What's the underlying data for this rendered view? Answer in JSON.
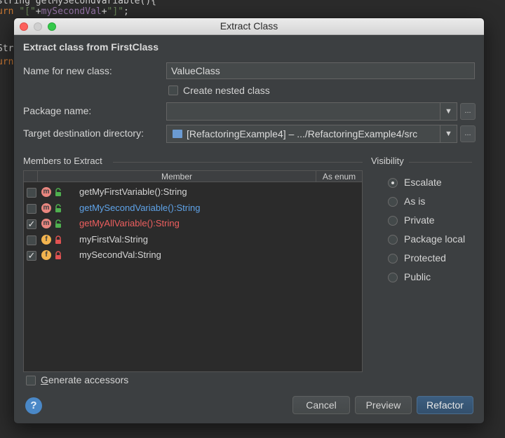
{
  "editor": {
    "line1": "string getMySecondVariable(){",
    "line2_kw": "urn ",
    "line2_s1": "\"[\"",
    "line2_plus1": "+",
    "line2_field": "mySecondVal",
    "line2_plus2": "+",
    "line2_s2": "\"]\"",
    "line2_end": ";",
    "line3": "Str",
    "line4": "urn"
  },
  "dialog": {
    "title": "Extract Class",
    "heading": "Extract class from FirstClass"
  },
  "form": {
    "name_label": "Name for new class:",
    "name_value": "ValueClass",
    "nested_label": "Create nested class",
    "nested_checked": false,
    "package_label": "Package name:",
    "package_value": "",
    "target_label": "Target destination directory:",
    "target_value": "[RefactoringExample4] – .../RefactoringExample4/src",
    "browse_label": "..."
  },
  "members": {
    "section_label": "Members to Extract",
    "col_member": "Member",
    "col_enum": "As enum",
    "rows": [
      {
        "kind": "m",
        "lock": "open",
        "text": "getMyFirstVariable():String",
        "checked": false,
        "color": "#d4d4d4"
      },
      {
        "kind": "m",
        "lock": "open",
        "text": "getMySecondVariable():String",
        "checked": false,
        "color": "#5fa3e8"
      },
      {
        "kind": "m",
        "lock": "open",
        "text": "getMyAllVariable():String",
        "checked": true,
        "color": "#ef5f5f"
      },
      {
        "kind": "f",
        "lock": "closed",
        "text": "myFirstVal:String",
        "checked": false,
        "color": "#d4d4d4"
      },
      {
        "kind": "f",
        "lock": "closed",
        "text": "mySecondVal:String",
        "checked": true,
        "color": "#d4d4d4"
      }
    ]
  },
  "visibility": {
    "section_label": "Visibility",
    "options": [
      {
        "label": "Escalate",
        "selected": true
      },
      {
        "label": "As is",
        "selected": false
      },
      {
        "label": "Private",
        "selected": false
      },
      {
        "label": "Package local",
        "selected": false
      },
      {
        "label": "Protected",
        "selected": false
      },
      {
        "label": "Public",
        "selected": false
      }
    ]
  },
  "generate_accessors": {
    "label": "Generate accessors",
    "checked": false
  },
  "buttons": {
    "help": "?",
    "cancel": "Cancel",
    "preview": "Preview",
    "refactor": "Refactor"
  },
  "colors": {
    "dialog_bg": "#3c3f41",
    "table_bg": "#2b2b2b",
    "primary_button": "#365880",
    "method_badge": "#e9867f",
    "field_badge": "#f3b44f"
  }
}
